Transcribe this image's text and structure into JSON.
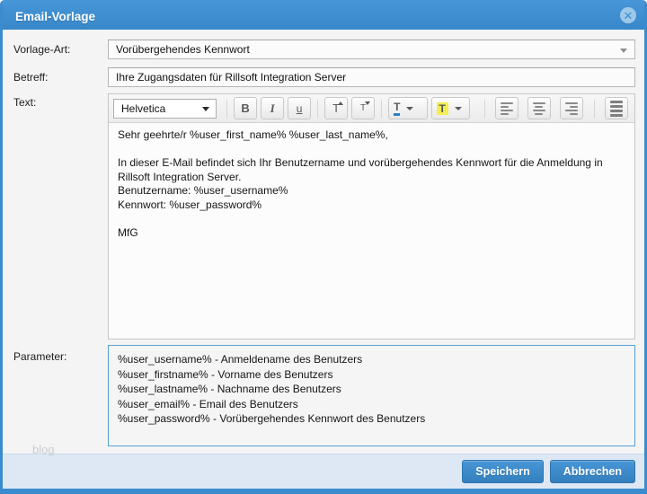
{
  "dialog": {
    "title": "Email-Vorlage",
    "close_glyph": "✕"
  },
  "form": {
    "vorlage_art": {
      "label": "Vorlage-Art:",
      "value": "Vorübergehendes Kennwort"
    },
    "betreff": {
      "label": "Betreff:",
      "value": "Ihre Zugangsdaten für Rillsoft Integration Server"
    },
    "text": {
      "label": "Text:",
      "toolbar": {
        "font": "Helvetica",
        "bold": "B",
        "italic": "I",
        "underline": "u",
        "size_up": "T",
        "size_down": "T",
        "text_color": "T",
        "highlight": "T"
      },
      "content": "Sehr geehrte/r %user_first_name% %user_last_name%,\n\nIn dieser E-Mail befindet sich Ihr Benutzername und vorübergehendes Kennwort für die Anmeldung in Rillsoft Integration Server.\nBenutzername: %user_username%\nKennwort: %user_password%\n\nMfG"
    },
    "parameter": {
      "label": "Parameter:",
      "items": [
        "%user_username% - Anmeldename des Benutzers",
        "%user_firstname% - Vorname des Benutzers",
        "%user_lastname% - Nachname des Benutzers",
        "%user_email% - Email des Benutzers",
        "%user_password% - Vorübergehendes Kennwort des Benutzers"
      ]
    }
  },
  "watermark": "blog",
  "footer": {
    "save_label": "Speichern",
    "cancel_label": "Abbrechen"
  },
  "colors": {
    "accent_blue": "#3a8cce",
    "text_color_swatch": "#2f7fc0",
    "highlight_swatch": "#f3ee52",
    "footer_bg": "#dde8f4"
  }
}
